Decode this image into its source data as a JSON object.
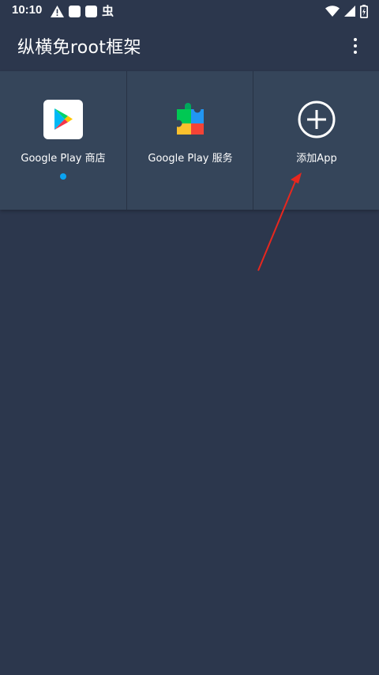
{
  "status_bar": {
    "time": "10:10",
    "left_icons": [
      "warning-icon",
      "notification-square-icon",
      "notification-square-icon",
      "app-notification-icon"
    ],
    "app_notification_glyph": "虫",
    "right_icons": [
      "wifi-icon",
      "signal-icon",
      "battery-icon"
    ]
  },
  "toolbar": {
    "title": "纵横免root框架",
    "overflow_icon": "more-vert-icon"
  },
  "apps": [
    {
      "label": "Google Play 商店",
      "icon": "google-play-store-icon",
      "running": true
    },
    {
      "label": "Google Play 服务",
      "icon": "google-play-services-icon",
      "running": false
    },
    {
      "label": "添加App",
      "icon": "add-circle-icon",
      "running": false
    }
  ],
  "colors": {
    "background": "#2c374d",
    "tile": "#35455a",
    "running_indicator": "#0aa3f2",
    "annotation_arrow": "#e8271e"
  }
}
